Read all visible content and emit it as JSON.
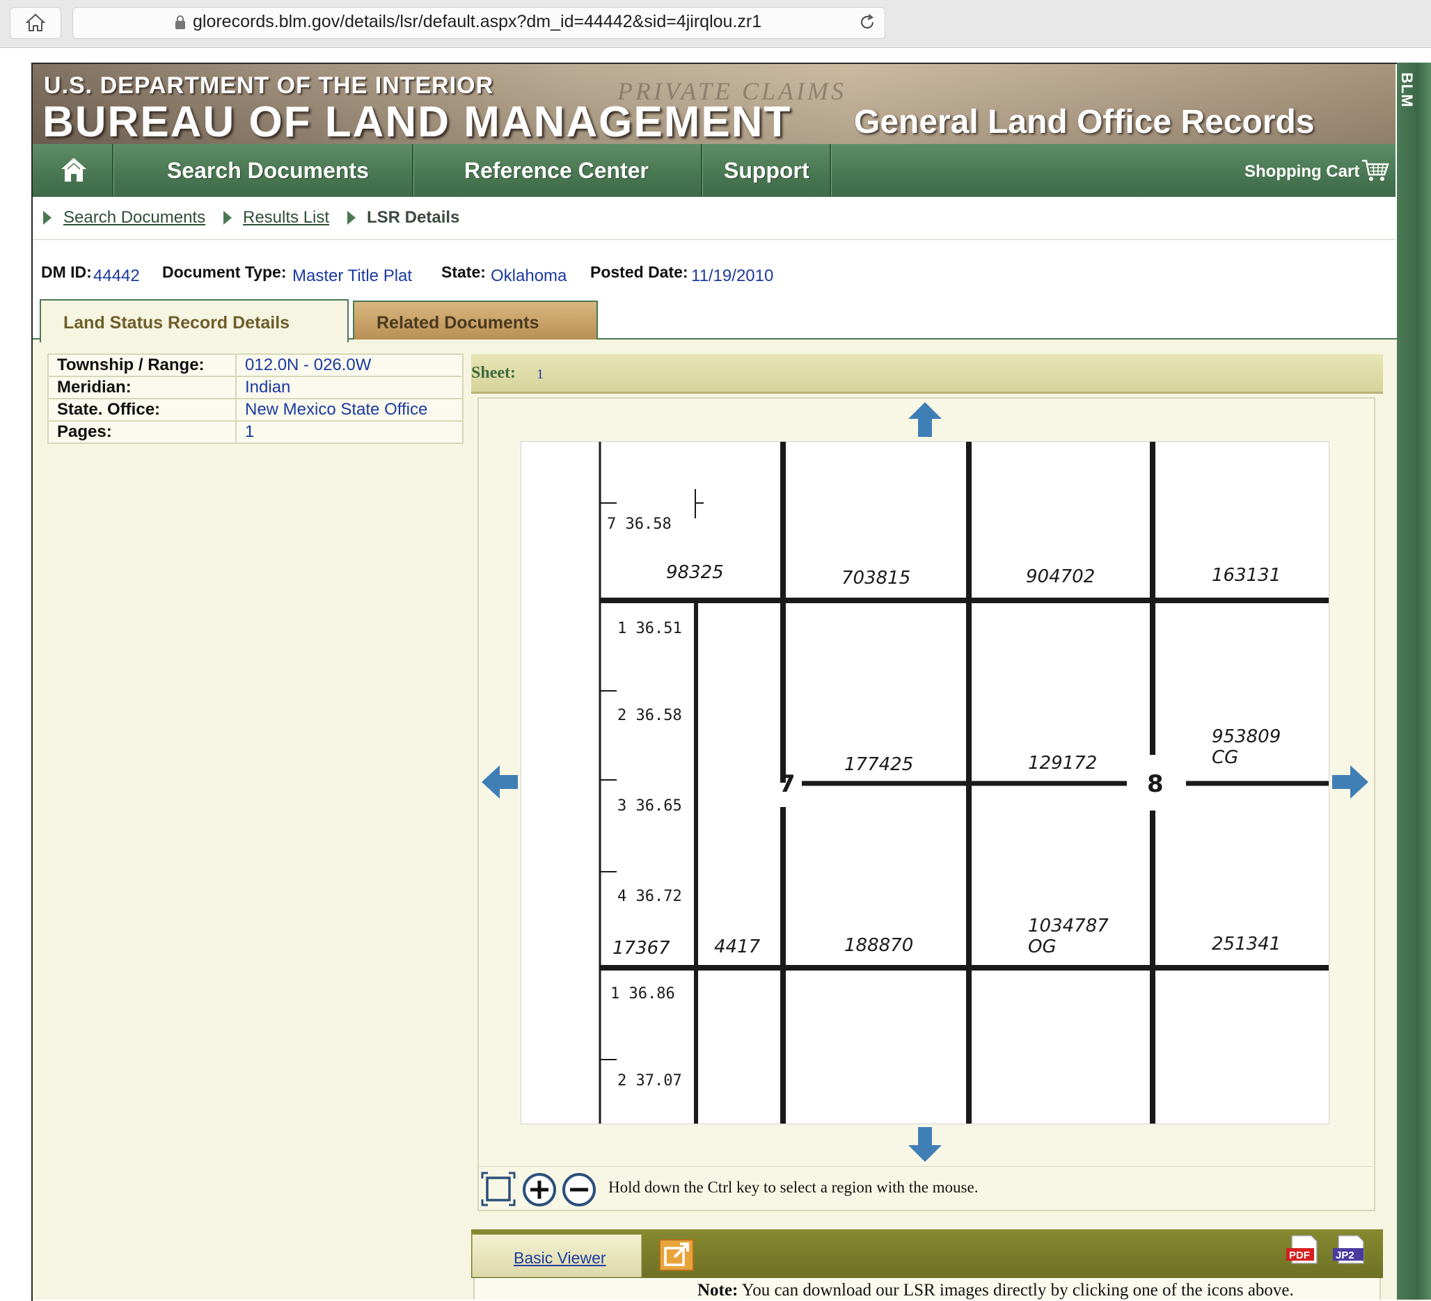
{
  "browser": {
    "url": "glorecords.blm.gov/details/lsr/default.aspx?dm_id=44442&sid=4jirqlou.zr1"
  },
  "header": {
    "department": "U.S. DEPARTMENT OF THE INTERIOR",
    "bureau": "BUREAU OF LAND MANAGEMENT",
    "background_text": "PRIVATE CLAIMS",
    "site_title": "General Land Office Records",
    "side_tab": "BLM"
  },
  "nav": {
    "items": [
      {
        "label": "Search Documents"
      },
      {
        "label": "Reference Center"
      },
      {
        "label": "Support"
      }
    ],
    "cart_label": "Shopping Cart"
  },
  "breadcrumb": [
    {
      "label": "Search Documents"
    },
    {
      "label": "Results List"
    },
    {
      "label": "LSR Details"
    }
  ],
  "meta": {
    "dm_id_label": "DM ID:",
    "dm_id": "44442",
    "doc_type_label": "Document Type:",
    "doc_type": "Master Title Plat",
    "state_label": "State:",
    "state": "Oklahoma",
    "posted_label": "Posted Date:",
    "posted": "11/19/2010"
  },
  "tabs": {
    "active": "Land Status Record Details",
    "related": "Related Documents"
  },
  "details": [
    {
      "label": "Township / Range:",
      "value": "012.0N - 026.0W"
    },
    {
      "label": "Meridian:",
      "value": "Indian"
    },
    {
      "label": "State. Office:",
      "value": "New Mexico State Office"
    },
    {
      "label": "Pages:",
      "value": "1"
    }
  ],
  "viewer": {
    "sheet_label": "Sheet:",
    "sheet_value": "1",
    "hint": "Hold down the Ctrl key to select a region with the mouse.",
    "basic_viewer": "Basic Viewer",
    "pdf_label": "PDF",
    "jp2_label": "JP2",
    "note_label": "Note:",
    "note_text": "You can download our LSR images directly by clicking one of the icons above."
  },
  "plat": {
    "lot_labels": [
      "7  36.58",
      "1  36.51",
      "2  36.58",
      "3  36.65",
      "4  36.72",
      "1  36.86",
      "2  37.07"
    ],
    "case_numbers": [
      "98325",
      "703815",
      "904702",
      "163131",
      "177425",
      "129172",
      "953809",
      "CG",
      "17367",
      "4417",
      "188870",
      "1034787",
      "OG",
      "251341"
    ],
    "section_numbers": [
      "7",
      "8"
    ]
  },
  "colors": {
    "nav_green": "#4a7853",
    "link_blue": "#1b3aa0",
    "viewer_olive": "#6e7125",
    "arrow_blue": "#3f7fb5"
  }
}
